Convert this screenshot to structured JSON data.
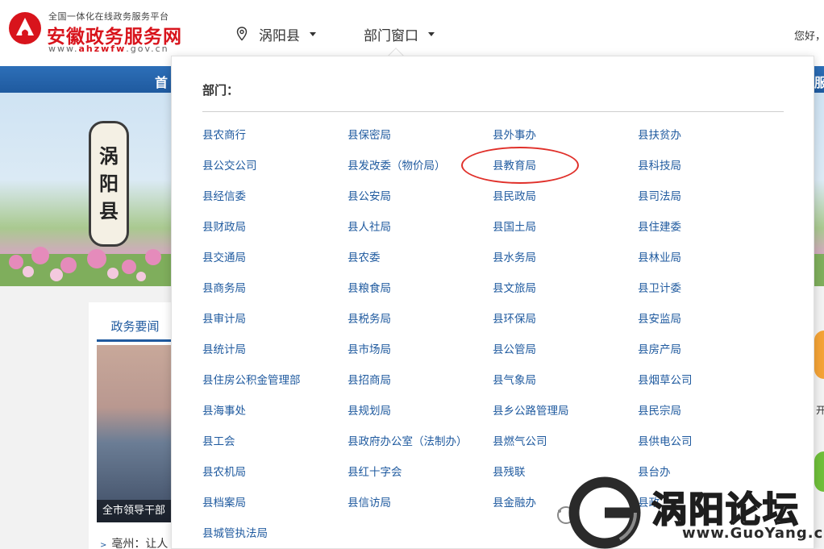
{
  "brand": {
    "subtitle": "全国一体化在线政务服务平台",
    "title": "安徽政务服务网",
    "url_prefix": "www.",
    "url_mid": "ahzwfw",
    "url_suffix": ".gov.cn",
    "color": "#d8141c"
  },
  "header": {
    "location_label": "涡阳县",
    "dept_window_label": "部门窗口",
    "greeting": "您好，"
  },
  "bluebar": {
    "left_text": "首",
    "right_text": "服"
  },
  "banner": {
    "county_chars": [
      "涡",
      "阳",
      "县"
    ]
  },
  "news": {
    "tab_label": "政务要闻",
    "caption": "全市领导干部",
    "item": "亳州：让人"
  },
  "right_strip": {
    "text": "开"
  },
  "dropdown": {
    "heading": "部门：",
    "items": [
      "县农商行",
      "县保密局",
      "县外事办",
      "县扶贫办",
      "县公交公司",
      "县发改委（物价局）",
      "县教育局",
      "县科技局",
      "县经信委",
      "县公安局",
      "县民政局",
      "县司法局",
      "县财政局",
      "县人社局",
      "县国土局",
      "县住建委",
      "县交通局",
      "县农委",
      "县水务局",
      "县林业局",
      "县商务局",
      "县粮食局",
      "县文旅局",
      "县卫计委",
      "县审计局",
      "县税务局",
      "县环保局",
      "县安监局",
      "县统计局",
      "县市场局",
      "县公管局",
      "县房产局",
      "县住房公积金管理部",
      "县招商局",
      "县气象局",
      "县烟草公司",
      "县海事处",
      "县规划局",
      "县乡公路管理局",
      "县民宗局",
      "县工会",
      "县政府办公室（法制办）",
      "县燃气公司",
      "县供电公司",
      "县农机局",
      "县红十字会",
      "县残联",
      "县台办",
      "县档案局",
      "县信访局",
      "县金融办",
      "县政",
      "县城管执法局"
    ],
    "highlighted": "县教育局"
  },
  "watermark": {
    "text": "涡阳论坛",
    "url": "www.GuoYang.cc"
  },
  "colors": {
    "nav_blue": "#1f5a9f",
    "link_blue": "#1f5a9f",
    "highlight_ring": "#e0302a"
  }
}
